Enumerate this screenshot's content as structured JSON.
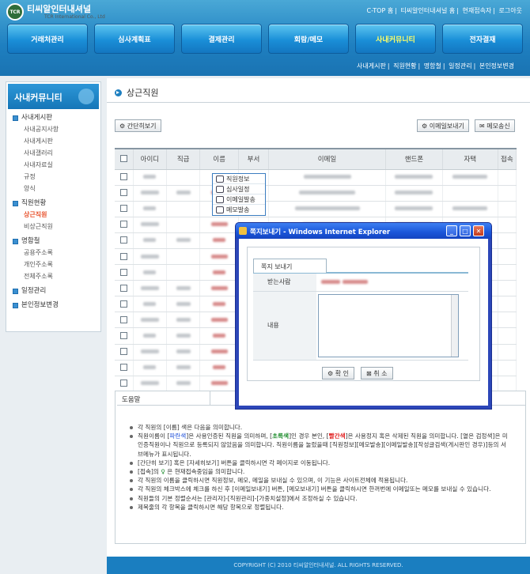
{
  "brand": {
    "name": "티씨알인터내셔널",
    "sub": "TCR International Co., Ltd",
    "logo_text": "TCR"
  },
  "top_links": [
    "C-TOP 홈",
    "티씨알인터내셔널 홈",
    "현재접속자",
    "로그아웃"
  ],
  "main_menu": [
    {
      "label": "거래처관리",
      "active": false
    },
    {
      "label": "심사계획표",
      "active": false
    },
    {
      "label": "결제관리",
      "active": false
    },
    {
      "label": "회람/메모",
      "active": false
    },
    {
      "label": "사내커뮤니티",
      "active": true
    },
    {
      "label": "전자결재",
      "active": false
    }
  ],
  "sub_menu": [
    "사내게시판",
    "직원현황",
    "명함철",
    "일정관리",
    "본인정보변경"
  ],
  "sidebar": {
    "title": "사내커뮤니티",
    "groups": [
      {
        "label": "사내게시판",
        "items": [
          "사내공지사항",
          "사내게시판",
          "사내갤러리",
          "사내자료실",
          "규정",
          "양식"
        ]
      },
      {
        "label": "직원현황",
        "items": [
          "상근직원",
          "비상근직원"
        ],
        "active": "상근직원"
      },
      {
        "label": "명함철",
        "items": [
          "공용주소록",
          "개인주소록",
          "전체주소록"
        ]
      },
      {
        "label": "일정관리",
        "items": []
      },
      {
        "label": "본인정보변경",
        "items": []
      }
    ]
  },
  "page": {
    "title": "상근직원",
    "btn_simple": "간단히보기",
    "btn_email": "이메일보내기",
    "btn_memo": "메모송신"
  },
  "table": {
    "headers": [
      "아이디",
      "직급",
      "이름",
      "부서",
      "이메일",
      "핸드폰",
      "자택",
      "접속"
    ],
    "row_count": 14
  },
  "context_menu": [
    "직원정보",
    "심사일정",
    "이메일발송",
    "메모발송"
  ],
  "dialog": {
    "title": "쪽지보내기 - Windows Internet Explorer",
    "tab": "쪽지 보내기",
    "recipient_label": "받는사람",
    "content_label": "내용",
    "ok": "확  인",
    "cancel": "취  소"
  },
  "help": {
    "tab": "도움말",
    "items": [
      [
        "각 직원의 [이름] 색은 다음을 의미합니다."
      ],
      [
        "직원이름이 [",
        "파란색",
        "]은 사용인증된 직원을 의미하며, [",
        "초록색",
        "]인 경우 본인, [",
        "빨간색",
        "]은 사용정지 혹은 삭제된 직원을 의미합니다. [옅은 검정색]은 미인증직원이나 직원으로 등록되지 않았음을 의미합니다. 직원이름을 눌렀을때 [직원정보][메모발송][이메일발송][작성글검색(게시판인 경우)]등의 서브메뉴가 표시됩니다."
      ],
      [
        "[간단히 보기] 혹은 [자세히보기] 버튼을 클릭하시면 각 페이지로 이동됩니다."
      ],
      [
        "[접속]의 ",
        "♀",
        " 은 현재접속중임을 의미합니다."
      ],
      [
        "각 직원의 이름을 클릭하시면 직원정보, 메모, 메일을 보내실 수 있으며, 이 기능은 사이트전체에 적용됩니다."
      ],
      [
        "각 직원의 체크박스에 체크를 하신 후 [이메일보내기] 버튼, [메모보내기] 버튼을 클릭하시면 한꺼번에 이메일또는 메모를 보내실 수 있습니다."
      ],
      [
        "직원들의 기본 정렬순서는 [관리자]-[직원관리]-[가중치설정]에서 조정하실 수 있습니다."
      ],
      [
        "제목줄의 각 항목을 클릭하시면 해당 항목으로 정렬됩니다."
      ]
    ]
  },
  "copyright": "COPYRIGHT (C) 2010 티씨알인터내셔널. ALL RIGHTS RESERVED.",
  "colors": {
    "header": "#1e7fc0",
    "menu_active_text": "#ffff66",
    "dialog_frame": "#2c46b8",
    "accent_sidebar": "#e8542f"
  }
}
